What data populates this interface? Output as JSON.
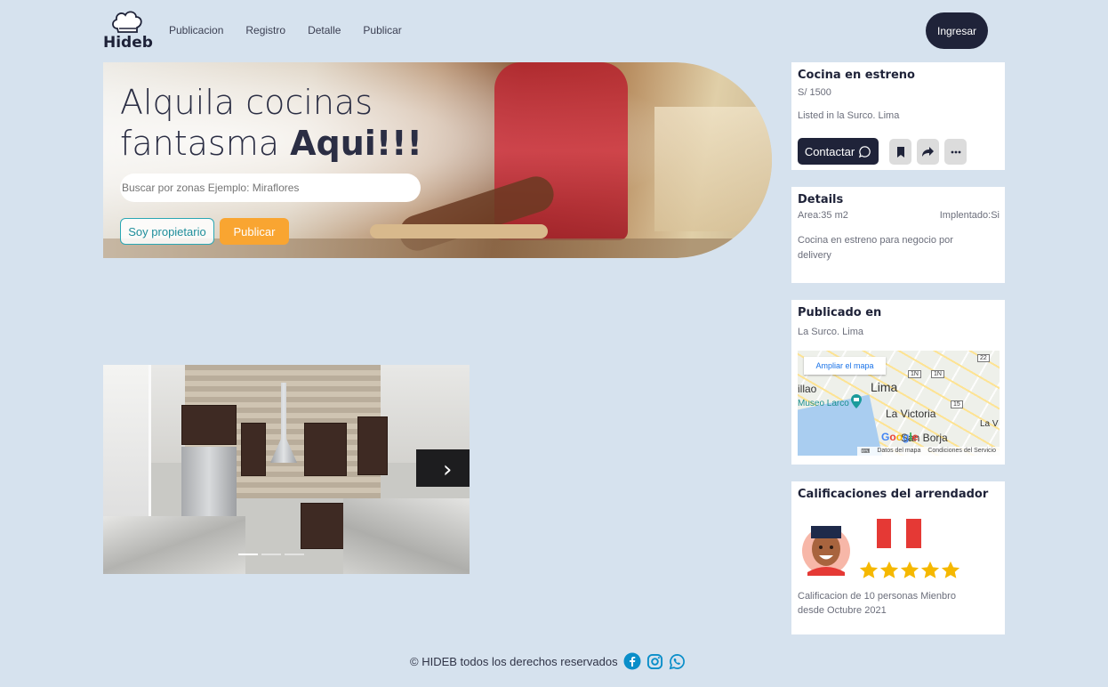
{
  "header": {
    "logo_text": "Hideb",
    "nav": [
      "Publicacion",
      "Registro",
      "Detalle",
      "Publicar"
    ],
    "login_label": "Ingresar"
  },
  "hero": {
    "title_line1": "Alquila cocinas",
    "title_line2_plain": "fantasma ",
    "title_line2_bold": "Aqui!!!",
    "search_placeholder": "Buscar por zonas Ejemplo: Miraflores",
    "owner_button": "Soy propietario",
    "publish_button": "Publicar"
  },
  "gallery": {
    "next_arrow": "›",
    "slides": 3,
    "active_slide": 1
  },
  "listing": {
    "title": "Cocina en estreno",
    "price": "S/ 1500",
    "location": "Listed in la Surco. Lima",
    "contact_button": "Contactar"
  },
  "details": {
    "title": "Details",
    "area": "Area:35 m2",
    "implemented": "Implentado:Si",
    "description": "Cocina en estreno para negocio por delivery"
  },
  "published": {
    "title": "Publicado en",
    "location": "La Surco. Lima",
    "map_button": "Ampliar el mapa",
    "map_labels": {
      "city": "Lima",
      "callao": "illao",
      "museum": "Museo Larco",
      "victoria": "La Victoria",
      "borja": "San Borja",
      "edge": "La V",
      "google": "Google"
    },
    "map_footer": [
      "Datos del mapa",
      "Condiciones del Servicio"
    ],
    "road_markers": [
      "1N",
      "1N",
      "22",
      "15"
    ]
  },
  "ratings": {
    "title": "Calificaciones del arrendador",
    "stars": 5,
    "summary": "Calificacion de 10 personas Mienbro desde Octubre 2021"
  },
  "footer": {
    "text": "© HIDEB todos los derechos reservados"
  },
  "colors": {
    "accent_dark": "#1f2339",
    "accent_orange": "#f9a531",
    "accent_teal": "#2aa7b4",
    "page_bg": "#d6e2ee",
    "star": "#f5b800"
  }
}
